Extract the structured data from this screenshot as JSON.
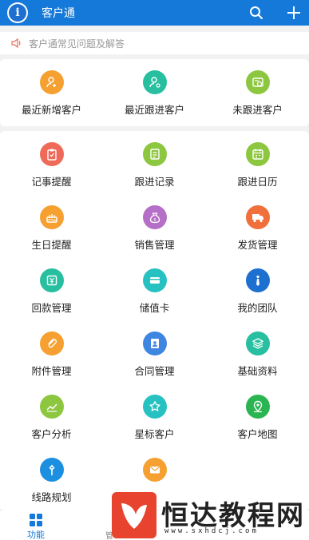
{
  "header": {
    "title": "客户通"
  },
  "notice": {
    "text": "客户通常见问题及解答"
  },
  "top_section": {
    "items": [
      {
        "label": "最近新增客户",
        "icon": "add-person-icon",
        "color": "#f5a030"
      },
      {
        "label": "最近跟进客户",
        "icon": "person-follow-icon",
        "color": "#27bf9f"
      },
      {
        "label": "未跟进客户",
        "icon": "unfollowed-card-icon",
        "color": "#8dc63f"
      }
    ]
  },
  "grid": {
    "items": [
      {
        "label": "记事提醒",
        "icon": "clipboard-icon",
        "color": "#f06a5a"
      },
      {
        "label": "跟进记录",
        "icon": "record-icon",
        "color": "#8dc63f"
      },
      {
        "label": "跟进日历",
        "icon": "calendar-icon",
        "color": "#8dc63f"
      },
      {
        "label": "生日提醒",
        "icon": "cake-icon",
        "color": "#f5a030"
      },
      {
        "label": "销售管理",
        "icon": "money-bag-icon",
        "color": "#b56fc6"
      },
      {
        "label": "发货管理",
        "icon": "truck-icon",
        "color": "#f0703c"
      },
      {
        "label": "回款管理",
        "icon": "yuan-icon",
        "color": "#27bf9f"
      },
      {
        "label": "储值卡",
        "icon": "card-icon",
        "color": "#27c1c1"
      },
      {
        "label": "我的团队",
        "icon": "team-icon",
        "color": "#1d6fd0"
      },
      {
        "label": "附件管理",
        "icon": "paperclip-icon",
        "color": "#f5a030"
      },
      {
        "label": "合同管理",
        "icon": "contract-icon",
        "color": "#3f86e0"
      },
      {
        "label": "基础资料",
        "icon": "layers-icon",
        "color": "#27bf9f"
      },
      {
        "label": "客户分析",
        "icon": "chart-line-icon",
        "color": "#8dc63f"
      },
      {
        "label": "星标客户",
        "icon": "star-icon",
        "color": "#27c1c1"
      },
      {
        "label": "客户地图",
        "icon": "map-pin-icon",
        "color": "#2bb552"
      },
      {
        "label": "线路规划",
        "icon": "route-icon",
        "color": "#1d8fe0"
      },
      {
        "label": "",
        "icon": "mail-icon",
        "color": "#f5a030"
      }
    ]
  },
  "tabbar": {
    "active_label": "功能",
    "partial_label": "管"
  },
  "watermark": {
    "text": "恒达教程网",
    "url": "www.sxhdcj.com"
  },
  "colors": {
    "brand": "#1479d8",
    "background": "#f2f2f2"
  }
}
